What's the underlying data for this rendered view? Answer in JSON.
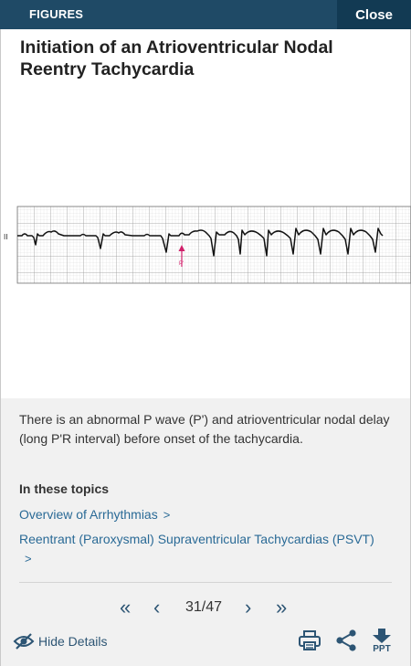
{
  "header": {
    "section_label": "FIGURES",
    "close_label": "Close"
  },
  "figure": {
    "title": "Initiation of an Atrioventricular Nodal Reentry Tachycardia",
    "lead_label": "II",
    "marker_label": "P'"
  },
  "details": {
    "caption": "There is an abnormal P wave (P') and atrioventricular nodal delay (long P'R interval) before onset of the tachycardia.",
    "topics_heading": "In these topics",
    "topics": [
      {
        "label": "Overview of Arrhythmias",
        "chevron": ">"
      },
      {
        "label": "Reentrant (Paroxysmal) Supraventricular Tachycardias (PSVT)",
        "chevron": ">"
      }
    ]
  },
  "pager": {
    "first": "«",
    "prev": "‹",
    "next": "›",
    "last": "»",
    "position": "31/47"
  },
  "footer": {
    "hide_details_label": "Hide Details",
    "ppt_label": "PPT"
  },
  "colors": {
    "header_bg": "#1f4a66",
    "close_bg": "#123a53",
    "link": "#2a6a96",
    "icon": "#2d5574",
    "marker": "#d0206a",
    "panel_bg": "#f1f1f1"
  }
}
